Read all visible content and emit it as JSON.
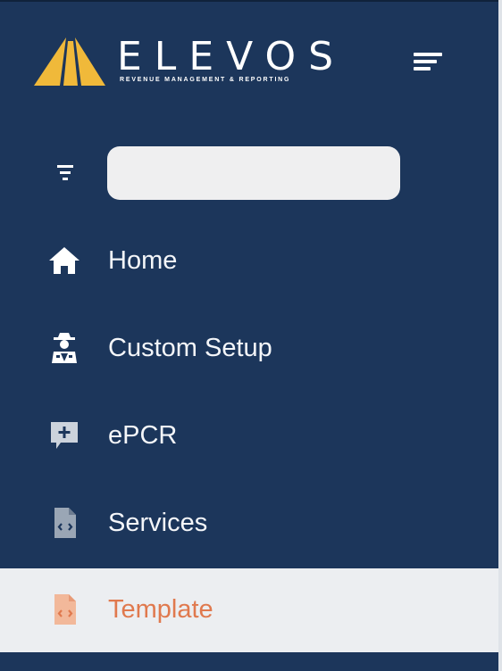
{
  "brand": {
    "name": "ELEVOS",
    "tagline": "REVENUE MANAGEMENT & REPORTING",
    "accent_color": "#f0b93a"
  },
  "header": {
    "menu_toggle_icon": "hamburger-icon"
  },
  "search": {
    "value": "",
    "placeholder": "",
    "filter_icon": "filter-icon"
  },
  "colors": {
    "sidebar_bg": "#1c365b",
    "active_bg": "#eceef1",
    "active_text": "#e0794e",
    "text": "#f4f6f9"
  },
  "nav": {
    "items": [
      {
        "label": "Home",
        "icon": "home-icon",
        "active": false
      },
      {
        "label": "Custom Setup",
        "icon": "agent-icon",
        "active": false
      },
      {
        "label": "ePCR",
        "icon": "add-comment-icon",
        "active": false
      },
      {
        "label": "Services",
        "icon": "code-file-icon",
        "active": false
      },
      {
        "label": "Template",
        "icon": "code-file-icon",
        "active": true
      }
    ]
  }
}
